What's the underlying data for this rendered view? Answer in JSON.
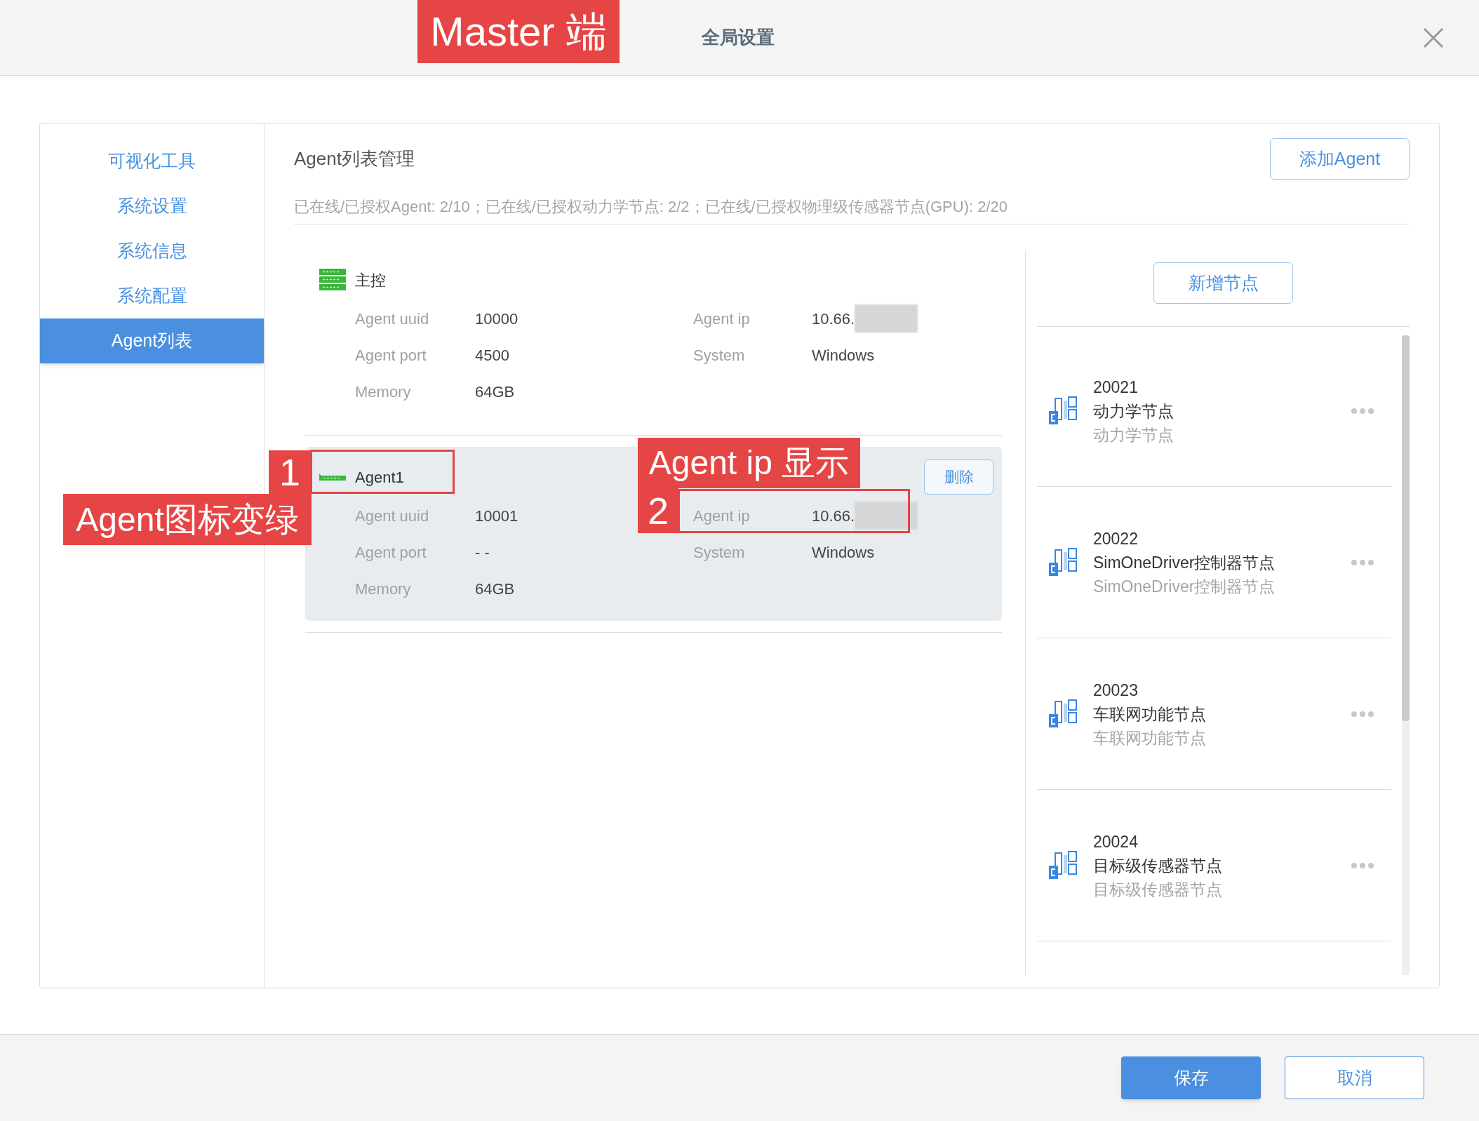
{
  "header": {
    "title": "全局设置"
  },
  "sidebar": {
    "items": [
      {
        "label": "可视化工具",
        "selected": false
      },
      {
        "label": "系统设置",
        "selected": false
      },
      {
        "label": "系统信息",
        "selected": false
      },
      {
        "label": "系统配置",
        "selected": false
      },
      {
        "label": "Agent列表",
        "selected": true
      }
    ]
  },
  "content": {
    "title": "Agent列表管理",
    "add_button": "添加Agent",
    "summary": "已在线/已授权Agent: 2/10；已在线/已授权动力学节点: 2/2；已在线/已授权物理级传感器节点(GPU): 2/20"
  },
  "agents": [
    {
      "kind": "master",
      "name": "主控",
      "selected": false,
      "fields": [
        {
          "label": "Agent uuid",
          "value": "10000"
        },
        {
          "label": "Agent ip",
          "value": "10.66.",
          "redacted": true
        },
        {
          "label": "Agent port",
          "value": "4500"
        },
        {
          "label": "System",
          "value": "Windows"
        },
        {
          "label": "Memory",
          "value": "64GB"
        }
      ]
    },
    {
      "kind": "agent",
      "name": "Agent1",
      "selected": true,
      "delete_button": "删除",
      "fields": [
        {
          "label": "Agent uuid",
          "value": "10001"
        },
        {
          "label": "Agent ip",
          "value": "10.66.",
          "redacted": true
        },
        {
          "label": "Agent port",
          "value": "- -"
        },
        {
          "label": "System",
          "value": "Windows"
        },
        {
          "label": "Memory",
          "value": "64GB"
        }
      ]
    }
  ],
  "nodes_panel": {
    "add_button": "新增节点",
    "nodes": [
      {
        "id": "20021",
        "name": "动力学节点",
        "description": "动力学节点"
      },
      {
        "id": "20022",
        "name": "SimOneDriver控制器节点",
        "description": "SimOneDriver控制器节点"
      },
      {
        "id": "20023",
        "name": "车联网功能节点",
        "description": "车联网功能节点"
      },
      {
        "id": "20024",
        "name": "目标级传感器节点",
        "description": "目标级传感器节点"
      }
    ]
  },
  "footer": {
    "save_button": "保存",
    "cancel_button": "取消"
  },
  "annotations": [
    "Master 端",
    "1",
    "Agent图标变绿",
    "Agent ip 显示",
    "2"
  ]
}
